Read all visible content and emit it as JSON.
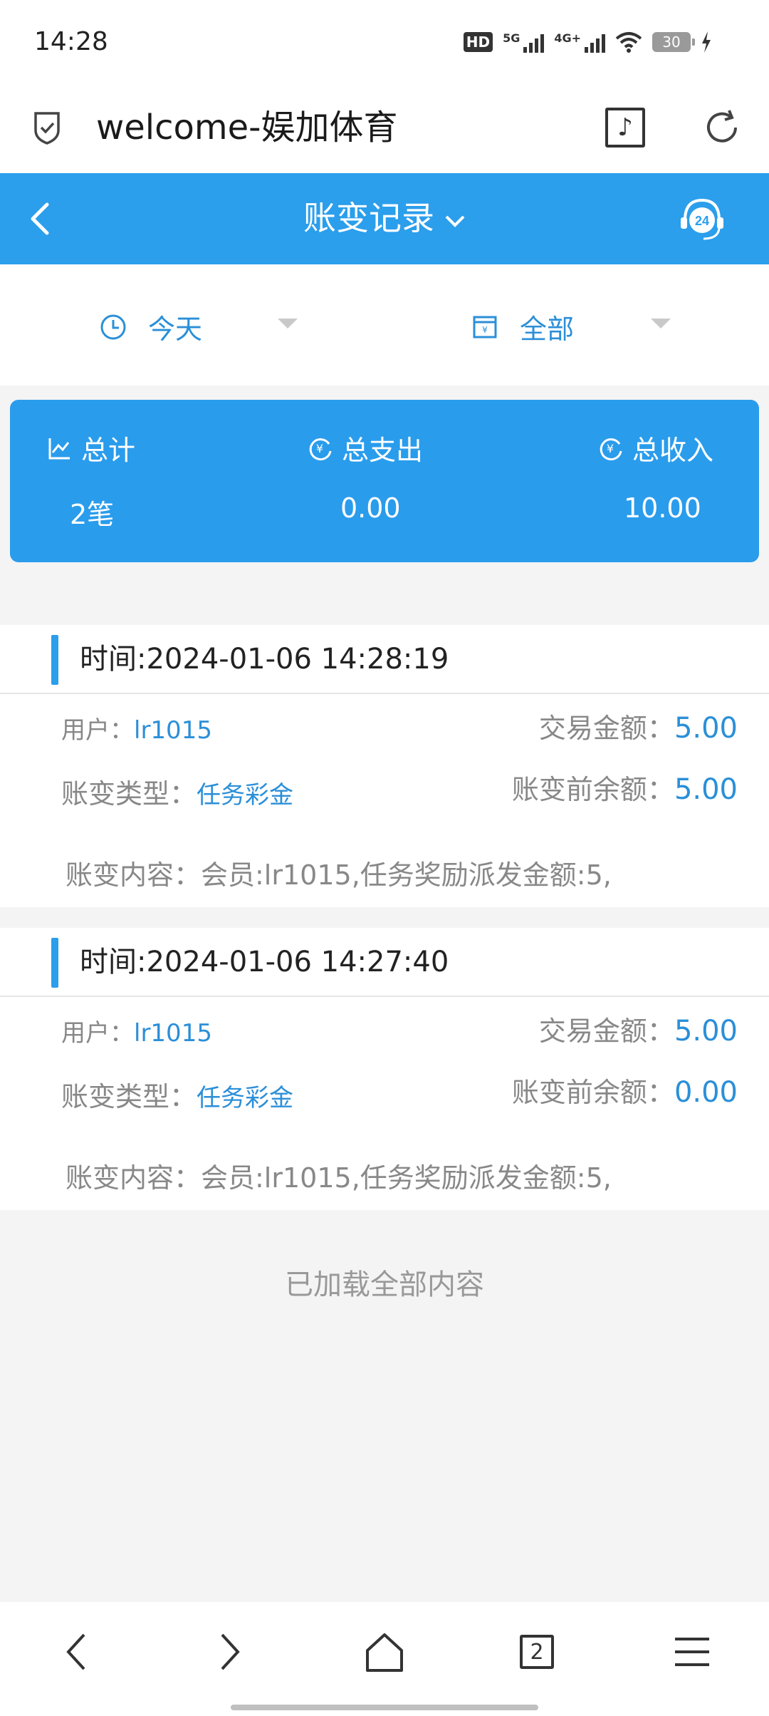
{
  "status": {
    "time": "14:28",
    "battery": "30",
    "hd": "HD",
    "signal1": "5G",
    "signal2": "4G+"
  },
  "browser": {
    "url": "welcome-娱加体育",
    "tab_count": "2"
  },
  "header": {
    "title": "账变记录"
  },
  "filters": {
    "date": "今天",
    "type": "全部"
  },
  "summary": {
    "total_label": "总计",
    "total_value": "2笔",
    "expense_label": "总支出",
    "expense_value": "0.00",
    "income_label": "总收入",
    "income_value": "10.00"
  },
  "records": [
    {
      "time": "时间:2024-01-06 14:28:19",
      "user_label": "用户：",
      "user": "lr1015",
      "amount_label": "交易金额：",
      "amount": "5.00",
      "type_label": "账变类型：",
      "type": "任务彩金",
      "before_label": "账变前余额：",
      "before": "5.00",
      "content": "账变内容：会员:lr1015,任务奖励派发金额:5,"
    },
    {
      "time": "时间:2024-01-06 14:27:40",
      "user_label": "用户：",
      "user": "lr1015",
      "amount_label": "交易金额：",
      "amount": "5.00",
      "type_label": "账变类型：",
      "type": "任务彩金",
      "before_label": "账变前余额：",
      "before": "0.00",
      "content": "账变内容：会员:lr1015,任务奖励派发金额:5,"
    }
  ],
  "footer": {
    "loaded": "已加载全部内容"
  },
  "colors": {
    "primary": "#2b9eec",
    "link": "#2b8fd8"
  }
}
